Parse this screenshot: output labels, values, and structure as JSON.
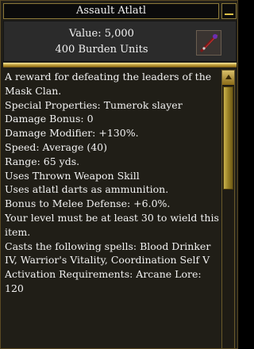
{
  "window": {
    "title": "Assault Atlatl",
    "close_icon": "close-icon"
  },
  "item": {
    "value": "Value: 5,000",
    "burden": "400 Burden Units",
    "icon": "atlatl-icon"
  },
  "description": {
    "lines": [
      "A reward for defeating the leaders of the Mask Clan.",
      "",
      "Special Properties: Tumerok slayer",
      "",
      "Damage Bonus: 0",
      "Damage Modifier: +130%.",
      "Speed: Average (40)",
      "Range: 65 yds.",
      "Uses Thrown Weapon Skill",
      "Uses atlatl darts as ammunition.",
      "Bonus to Melee Defense: +6.0%.",
      "",
      "Your level must be at least 30 to wield this item.",
      "",
      "Casts the following spells: Blood Drinker IV, Warrior's Vitality, Coordination Self V",
      "",
      "Activation Requirements: Arcane Lore: 120"
    ]
  },
  "colors": {
    "panel_bg": "#201e17",
    "text": "#f2f2f2",
    "gold": "#c2a03a"
  }
}
